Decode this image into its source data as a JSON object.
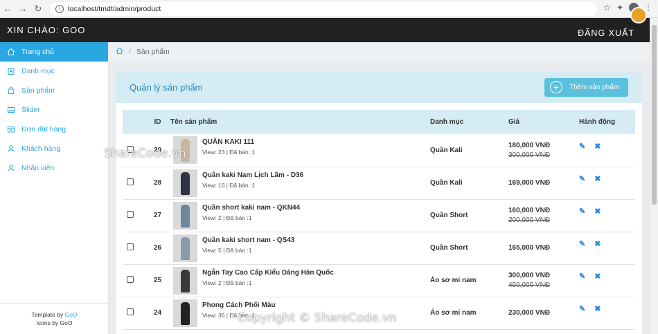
{
  "browser": {
    "url": "localhost/tmdt/admin/product"
  },
  "header": {
    "greeting": "XIN CHÀO: GOO",
    "logout": "ĐĂNG XUẤT"
  },
  "sidebar": {
    "items": [
      {
        "label": "Trang chủ",
        "icon": "home-icon",
        "active": true
      },
      {
        "label": "Danh mục",
        "icon": "list-icon",
        "active": false
      },
      {
        "label": "Sản phẩm",
        "icon": "bag-icon",
        "active": false
      },
      {
        "label": "Slider",
        "icon": "image-icon",
        "active": false
      },
      {
        "label": "Đơn đặt hàng",
        "icon": "order-icon",
        "active": false
      },
      {
        "label": "Khách hàng",
        "icon": "user-icon",
        "active": false
      },
      {
        "label": "Nhân viên",
        "icon": "staff-icon",
        "active": false
      }
    ],
    "footer": {
      "template_prefix": "Template by",
      "template_link": "GoO",
      "icons_text": "Icons by GoO"
    }
  },
  "breadcrumb": {
    "current": "Sản phẩm"
  },
  "panel": {
    "title": "Quản lý sản phẩm",
    "add_label": "Thêm sản phẩm"
  },
  "table": {
    "headers": {
      "id": "ID",
      "name": "Tên sản phẩm",
      "category": "Danh mục",
      "price": "Giá",
      "action": "Hành động"
    },
    "rows": [
      {
        "id": "29",
        "name": "QUẦN KAKI 111",
        "meta": "View: 23 | Đã bán :1",
        "category": "Quần Kali",
        "price": "180,000 VNĐ",
        "old_price": "300,000 VNĐ",
        "thumb_color": "#c9b7a0"
      },
      {
        "id": "28",
        "name": "Quần kaki Nam Lịch Lãm - D36",
        "meta": "View: 16 | Đã bán :1",
        "category": "Quần Kali",
        "price": "169,000 VNĐ",
        "old_price": "",
        "thumb_color": "#2f3440"
      },
      {
        "id": "27",
        "name": "Quần short kaki nam - QKN44",
        "meta": "View: 2 | Đã bán :1",
        "category": "Quần Short",
        "price": "160,000 VNĐ",
        "old_price": "200,000 VNĐ",
        "thumb_color": "#6f86a0"
      },
      {
        "id": "26",
        "name": "Quần kaki short nam - QS43",
        "meta": "View: 5 | Đã bán :1",
        "category": "Quần Short",
        "price": "165,000 VNĐ",
        "old_price": "",
        "thumb_color": "#8a9aa7"
      },
      {
        "id": "25",
        "name": "Ngắn Tay Cao Cấp Kiểu Dáng Hàn Quốc",
        "meta": "View: 2 | Đã bán :1",
        "category": "Áo sơ mi nam",
        "price": "300,000 VNĐ",
        "old_price": "450,000 VNĐ",
        "thumb_color": "#3a3a3a"
      },
      {
        "id": "24",
        "name": "Phong Cách Phối Màu",
        "meta": "View: 36 | Đã bán :1",
        "category": "Áo sơ mi nam",
        "price": "230,000 VNĐ",
        "old_price": "",
        "thumb_color": "#222222"
      }
    ]
  },
  "watermarks": {
    "top": "ShareCode.vn",
    "bottom": "Copyright © ShareCode.vn",
    "logo": "SHARECODE.vn"
  },
  "colors": {
    "accent": "#2aa7e0",
    "header_bg": "#212121",
    "panel_head": "#d5ecf5",
    "add_button": "#5bc0de"
  }
}
